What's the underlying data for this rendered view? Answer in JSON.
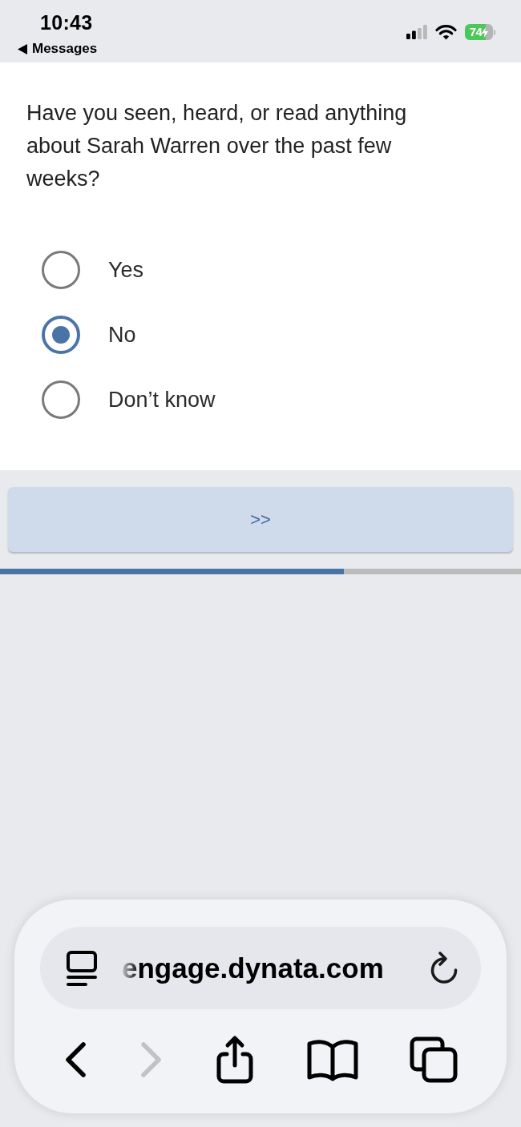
{
  "status_bar": {
    "time": "10:43",
    "back_app": "Messages",
    "battery": {
      "text": "74",
      "charging": true
    }
  },
  "question": "Have you seen, heard, or read anything about Sarah Warren over the past few weeks?",
  "options": [
    {
      "label": "Yes",
      "selected": false
    },
    {
      "label": "No",
      "selected": true
    },
    {
      "label": "Don’t know",
      "selected": false
    }
  ],
  "next_button": {
    "label": ">>"
  },
  "progress": {
    "level": 0.66
  },
  "browser": {
    "url": "engage.dynata.com",
    "toolbar": [
      {
        "kind": "back",
        "disabled": false
      },
      {
        "kind": "forward",
        "disabled": true
      },
      {
        "kind": "share",
        "disabled": false
      },
      {
        "kind": "bookmarks",
        "disabled": false
      },
      {
        "kind": "tabs",
        "disabled": false
      }
    ]
  }
}
